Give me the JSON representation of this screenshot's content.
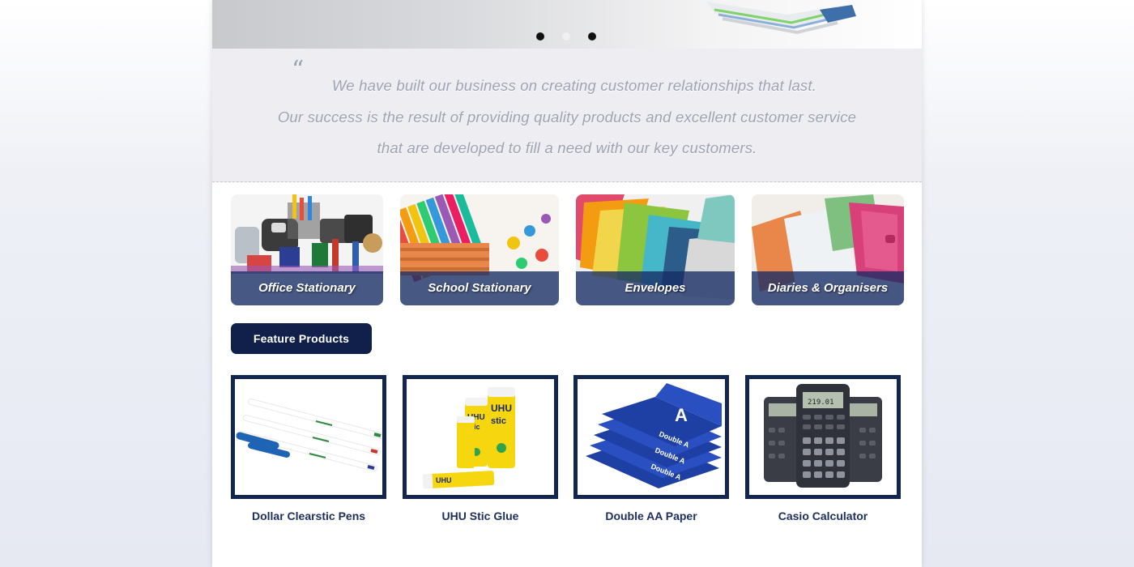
{
  "slider": {
    "dots": 3,
    "active_dot": 2
  },
  "quote": {
    "mark": "“",
    "lines": [
      "We have built our business on creating customer relationships that last.",
      "Our success is the result of providing quality products and excellent customer service",
      "that are developed to fill a need with our key customers."
    ]
  },
  "categories": [
    {
      "label": "Office Stationary",
      "icon": "office-stationary-photo"
    },
    {
      "label": "School Stationary",
      "icon": "school-stationary-photo"
    },
    {
      "label": "Envelopes",
      "icon": "envelopes-photo"
    },
    {
      "label": "Diaries & Organisers",
      "icon": "diaries-photo"
    }
  ],
  "feature": {
    "label": "Feature Products"
  },
  "products": [
    {
      "name": "Dollar Clearstic Pens",
      "icon": "pens-photo"
    },
    {
      "name": "UHU Stic Glue",
      "icon": "glue-stick-photo"
    },
    {
      "name": "Double AA Paper",
      "icon": "paper-ream-photo"
    },
    {
      "name": "Casio Calculator",
      "icon": "calculator-photo"
    }
  ],
  "colors": {
    "navy": "#10204a",
    "frame": "#132650",
    "band": "#162c64",
    "quote_text": "#9ea3b3",
    "quote_bg": "#eeeef2"
  }
}
